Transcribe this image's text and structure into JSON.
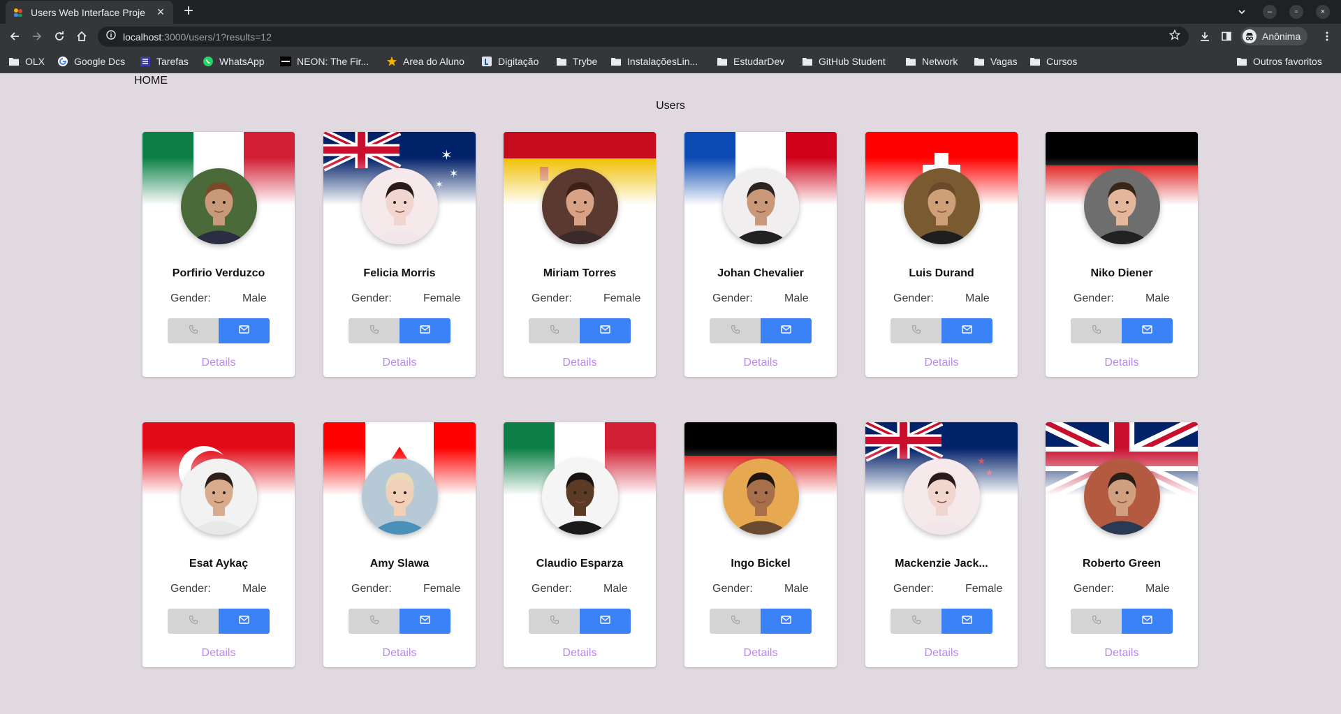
{
  "browser": {
    "tab_title": "Users Web Interface Proje",
    "url_host": "localhost",
    "url_rest": ":3000/users/1?results=12",
    "profile_name": "Anônima",
    "bookmarks": [
      {
        "label": "OLX",
        "icon": "folder-icon"
      },
      {
        "label": "Google Dcs",
        "icon": "google-icon"
      },
      {
        "label": "Tarefas",
        "icon": "tasks-icon"
      },
      {
        "label": "WhatsApp",
        "icon": "whatsapp-icon"
      },
      {
        "label": "NEON: The Fir...",
        "icon": "neon-icon"
      },
      {
        "label": "Area do Aluno",
        "icon": "star-icon"
      },
      {
        "label": "Digitação",
        "icon": "typing-icon"
      },
      {
        "label": "Trybe",
        "icon": "folder-icon"
      },
      {
        "label": "InstalaçõesLin...",
        "icon": "folder-icon"
      },
      {
        "label": "EstudarDev",
        "icon": "folder-icon"
      },
      {
        "label": "GitHub Student",
        "icon": "folder-icon"
      },
      {
        "label": "Network",
        "icon": "folder-icon"
      },
      {
        "label": "Vagas",
        "icon": "folder-icon"
      },
      {
        "label": "Cursos",
        "icon": "folder-icon"
      }
    ],
    "other_bookmarks": "Outros favoritos"
  },
  "page": {
    "home": "HOME",
    "title": "Users"
  },
  "labels": {
    "gender": "Gender:",
    "details": "Details"
  },
  "users": [
    {
      "name": "Porfirio Verduzco",
      "gender": "Male",
      "flag": "mexico",
      "skin": "#c99a7a",
      "hair": "#7a4a28",
      "bg": "#4a6a3a",
      "shirt": "#2b2d42"
    },
    {
      "name": "Felicia Morris",
      "gender": "Female",
      "flag": "australia",
      "skin": "#f1d6cf",
      "hair": "#2a1a1a",
      "bg": "#f5e9ec",
      "shirt": "#f3e6ea"
    },
    {
      "name": "Miriam Torres",
      "gender": "Female",
      "flag": "spain",
      "skin": "#d8a286",
      "hair": "#3d2014",
      "bg": "#5a3a30",
      "shirt": "#3b2a2a"
    },
    {
      "name": "Johan Chevalier",
      "gender": "Male",
      "flag": "france",
      "skin": "#c89878",
      "hair": "#2b2420",
      "bg": "#f0eeee",
      "shirt": "#222222"
    },
    {
      "name": "Luis Durand",
      "gender": "Male",
      "flag": "switzerland",
      "skin": "#cf9f78",
      "hair": "#6a4a2a",
      "bg": "#7a5a30",
      "shirt": "#1e1e1e"
    },
    {
      "name": "Niko Diener",
      "gender": "Male",
      "flag": "germany",
      "skin": "#e2b79b",
      "hair": "#3a2618",
      "bg": "#6e6e6e",
      "shirt": "#222222"
    },
    {
      "name": "Esat Aykaç",
      "gender": "Male",
      "flag": "turkey",
      "skin": "#d9ab8d",
      "hair": "#2e2018",
      "bg": "#f2f2f2",
      "shirt": "#e8e8e8"
    },
    {
      "name": "Amy Slawa",
      "gender": "Female",
      "flag": "canada",
      "skin": "#f0d0b6",
      "hair": "#e9dbb8",
      "bg": "#b5c9d6",
      "shirt": "#4a90b8"
    },
    {
      "name": "Claudio Esparza",
      "gender": "Male",
      "flag": "mexico",
      "skin": "#5b3a26",
      "hair": "#1a1210",
      "bg": "#f5f5f5",
      "shirt": "#1a1a1a"
    },
    {
      "name": "Ingo Bickel",
      "gender": "Male",
      "flag": "germany",
      "skin": "#a8704a",
      "hair": "#1e1410",
      "bg": "#e6a850",
      "shirt": "#6a4a30"
    },
    {
      "name": "Mackenzie Jack...",
      "gender": "Female",
      "flag": "new-zealand",
      "skin": "#f1d6cf",
      "hair": "#2a1a1a",
      "bg": "#f5e9ec",
      "shirt": "#f3e6ea"
    },
    {
      "name": "Roberto Green",
      "gender": "Male",
      "flag": "uk",
      "skin": "#d0a080",
      "hair": "#2a1e18",
      "bg": "#b45a40",
      "shirt": "#2a3a55"
    }
  ],
  "colors": {
    "mail_button": "#3b82f6",
    "phone_button": "#d4d4d4",
    "details_link": "#c084fc",
    "page_background": "#e0d9e0"
  }
}
